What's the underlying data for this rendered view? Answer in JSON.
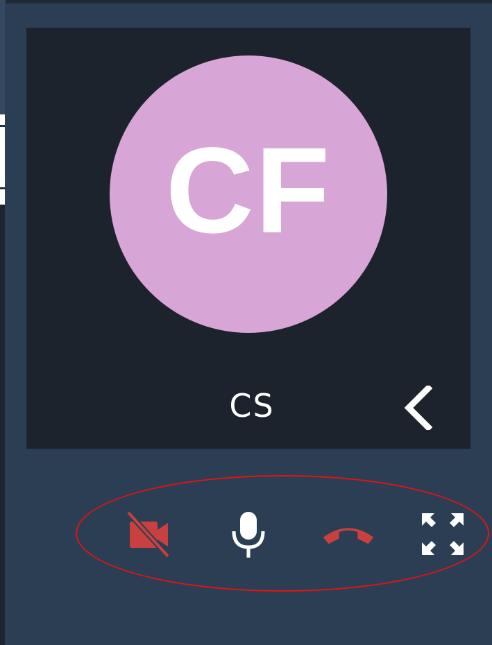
{
  "call": {
    "avatar_initials": "CF",
    "participant_name": "CS"
  },
  "icons": {
    "collapse": "chevron-left-icon",
    "camera": "video-off-icon",
    "mic": "microphone-icon",
    "hangup": "phone-hangup-icon",
    "fullscreen": "expand-arrows-icon"
  },
  "colors": {
    "panel_bg": "#2c3e53",
    "video_bg": "#1c232d",
    "avatar_bg": "#d7a6d6",
    "icon_white": "#ffffff",
    "danger_red": "#c94040",
    "highlight_ring": "#e01414"
  }
}
